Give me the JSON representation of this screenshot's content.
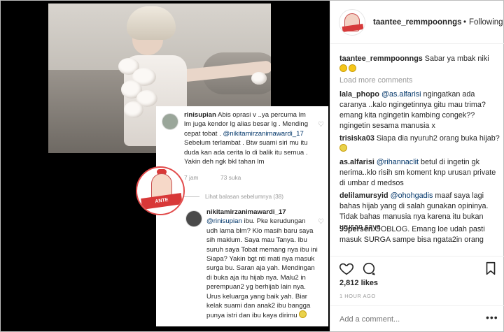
{
  "post": {
    "username": "taantee_remmpoonngs",
    "follow_state": "Following",
    "separator": "•",
    "caption": "Sabar ya mbak niki",
    "load_more": "Load more comments",
    "likes": "2,812 likes",
    "time_ago": "1 HOUR AGO",
    "add_comment_placeholder": "Add a comment...",
    "more_menu": "•••"
  },
  "comments": [
    {
      "user": "lala_phopo",
      "mention": "@as.alfarisi",
      "text": " ngingatkan ada caranya ..kalo ngingetinnya gitu mau trima? emang kita ngingetin kambing congek?? ngingetin sesama manusia x"
    },
    {
      "user": "trisiska03",
      "mention": "",
      "text": " Siapa dia nyuruh2 orang buka hijab?"
    },
    {
      "user": "as.alfarisi",
      "mention": "@rihannaclit",
      "text": " betul di ingetin gk nerima..klo risih sm koment knp urusan private di umbar d medsos"
    },
    {
      "user": "delilamursyid",
      "mention": "@ohohgadis",
      "text": " maaf saya lagi bahas hijab yang di salah gunakan opininya. Tidak bahas manusia nya karena itu bukan urusan saya"
    },
    {
      "user": "99persen",
      "mention": "",
      "text": " GOBLOG. Emang loe udah pasti masuk SURGA sampe bisa ngata2in orang"
    }
  ],
  "card": {
    "c1_user": "rinisupian",
    "c1_text": " Abis oprasi v ..ya percuma lm lm juga kendor lg alias besar lg . Mending cepat tobat .",
    "c1_mention": "@nikitamirzanimawardi_17",
    "c1_text2": " Sebelum terlambat . Btw suami siri mu itu duda kan ada cerita lo di balik itu semua . Yakin deh ngk bkl tahan lm",
    "c1_time": "7 jam",
    "c1_likes": "73 suka",
    "replies_link": "Lihat balasan sebelumnya (38)",
    "c2_user": "nikitamirzanimawardi_17",
    "c2_mention": "@rinisupian",
    "c2_text": " ibu. Pke kerudungan udh lama blm? Klo masih baru saya sih maklum. Saya mau Tanya. Ibu suruh saya Tobat memang nya ibu ini Siapa? Yakin bgt nti mati nya masuk surga bu. Saran aja yah. Mendingan di buka aja itu hijab nya. Malu2 in perempuan2 yg berhijab lain nya. Urus keluarga yang baik yah. Biar kelak suami dan anak2 ibu bangga punya istri dan ibu kaya dirimu",
    "logo_text": "ANTE"
  },
  "colors": {
    "mention": "#003569",
    "muted": "#999999",
    "logo_red": "#d83838"
  }
}
